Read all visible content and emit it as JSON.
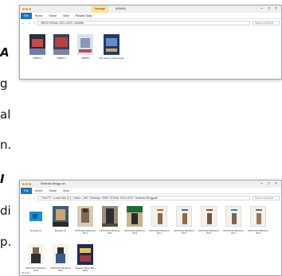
{
  "background_document": {
    "lines": [
      {
        "text": "A",
        "style": "bold-italic"
      },
      {
        "text": "g",
        "style": "normal"
      },
      {
        "text": "al",
        "style": "normal"
      },
      {
        "text": "n.",
        "style": "normal"
      },
      {
        "text": "I",
        "style": "bold-italic"
      },
      {
        "text": "di",
        "style": "normal"
      },
      {
        "text": "p.",
        "style": "normal"
      }
    ]
  },
  "window_top": {
    "ribbon_context_tab": "Manage",
    "title": "ADMINI",
    "ribbon_tabs": {
      "file": "File",
      "home": "Home",
      "share": "Share",
      "view": "View",
      "picture_tools": "Picture Tools"
    },
    "nav_buttons": "← → ↑",
    "address": "›  BIRO SOSIAL 2021-2023  ›  ADMINI",
    "search_placeholder": "Search ADMINI",
    "controls": {
      "minimize": "–",
      "maximize": "□",
      "close": "×"
    },
    "files": [
      {
        "name": "ADMINI 2",
        "colors": [
          "#2b2f3a",
          "#c84a4a",
          "#6a7fa8"
        ]
      },
      {
        "name": "ADMINI 1",
        "colors": [
          "#3a3f58",
          "#b8413f",
          "#7a86a6"
        ]
      },
      {
        "name": "ADMINI",
        "colors": [
          "#d7e2f0",
          "#8a97b5",
          "#c24a4e"
        ]
      },
      {
        "name": "zuzu Admin media massa",
        "colors": [
          "#1f3c6e",
          "#6b8bc4",
          "#d4a44c"
        ]
      }
    ]
  },
  "window_bottom": {
    "title": "Motivasi Minggu-an",
    "ribbon_tabs": {
      "file": "File",
      "home": "Home",
      "share": "Share",
      "view": "View"
    },
    "nav_buttons": "← → ↑",
    "address": "›  This PC  ›  Local Disk (C:)  ›  Users  ›  Dell  ›  Desktop  ›  BIRO SOSIAL 2021-2023  ›  Motivasi Mingguan",
    "search_placeholder": "Search Motivas",
    "controls": {
      "minimize": "–",
      "maximize": "□",
      "close": "×"
    },
    "status": "20 items",
    "files": [
      {
        "name": "Motivasi 10",
        "colors": [
          "#1a8fd6",
          "#ffffff",
          "#0b5fa0"
        ]
      },
      {
        "name": "Motivasi 12",
        "colors": [
          "#3d5a80",
          "#c9a66b",
          "#2b2b2b"
        ]
      },
      {
        "name": "MOTIVASI MINGGU INI 1",
        "colors": [
          "#7a6a55",
          "#d8cbb4",
          "#3b3328"
        ]
      },
      {
        "name": "MOTIVASI MINGGU INI 2",
        "colors": [
          "#2e2e2e",
          "#9a8b7a",
          "#5a4a3a"
        ]
      },
      {
        "name": "MOTIVASI MINGGU INI 3",
        "colors": [
          "#1e6b3e",
          "#c7b38a",
          "#2a2a2a"
        ]
      },
      {
        "name": "MOTIVASI MINGGU INI 4",
        "colors": [
          "#f4f1ea",
          "#d9534f",
          "#8b6b4a"
        ]
      },
      {
        "name": "MOTIVASI MINGGU INI 5",
        "colors": [
          "#f4f1ea",
          "#3a6ea5",
          "#8b6b4a"
        ]
      },
      {
        "name": "MOTIVASI MINGGU INI 6",
        "colors": [
          "#f4f1ea",
          "#c0392b",
          "#6d5a45"
        ]
      },
      {
        "name": "MOTIVASI MINGGU INI 7",
        "colors": [
          "#f4f1ea",
          "#2e86c1",
          "#7a6650"
        ]
      },
      {
        "name": "MOTIVASI MINGGU INI 8",
        "colors": [
          "#f4f1ea",
          "#5d6d7e",
          "#9b7b55"
        ]
      },
      {
        "name": "MOTIVASI MINGGU INI 8",
        "colors": [
          "#f7f3ea",
          "#7a6650",
          "#2f2f2f"
        ]
      },
      {
        "name": "MOTIVASI MINGGU INI 9",
        "colors": [
          "#f7f3ea",
          "#3b5b8a",
          "#2f2f2f"
        ]
      },
      {
        "name": "Selamat Tahun Baru 2023",
        "colors": [
          "#1c2a5a",
          "#e8c35a",
          "#a33a3a"
        ]
      }
    ]
  }
}
